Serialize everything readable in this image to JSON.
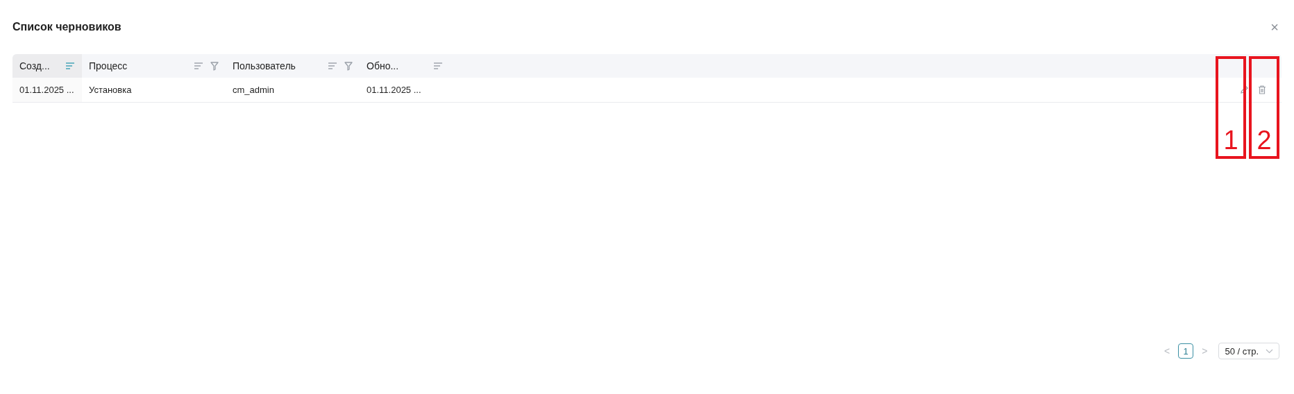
{
  "dialog": {
    "title": "Список черновиков",
    "close": "×"
  },
  "table": {
    "columns": [
      {
        "label": "Созд...",
        "sorted": true,
        "filterable": false
      },
      {
        "label": "Процесс",
        "sorted": false,
        "filterable": true
      },
      {
        "label": "Пользователь",
        "sorted": false,
        "filterable": true
      },
      {
        "label": "Обно...",
        "sorted": false,
        "filterable": false
      }
    ],
    "rows": [
      {
        "cells": [
          "01.11.2025 ...",
          "Установка",
          "cm_admin",
          "01.11.2025 ..."
        ]
      }
    ]
  },
  "annotations": [
    {
      "label": "1"
    },
    {
      "label": "2"
    }
  ],
  "pagination": {
    "prev": "<",
    "pages": [
      {
        "label": "1",
        "selected": true
      }
    ],
    "next": ">",
    "page_size": "50 / стр."
  }
}
